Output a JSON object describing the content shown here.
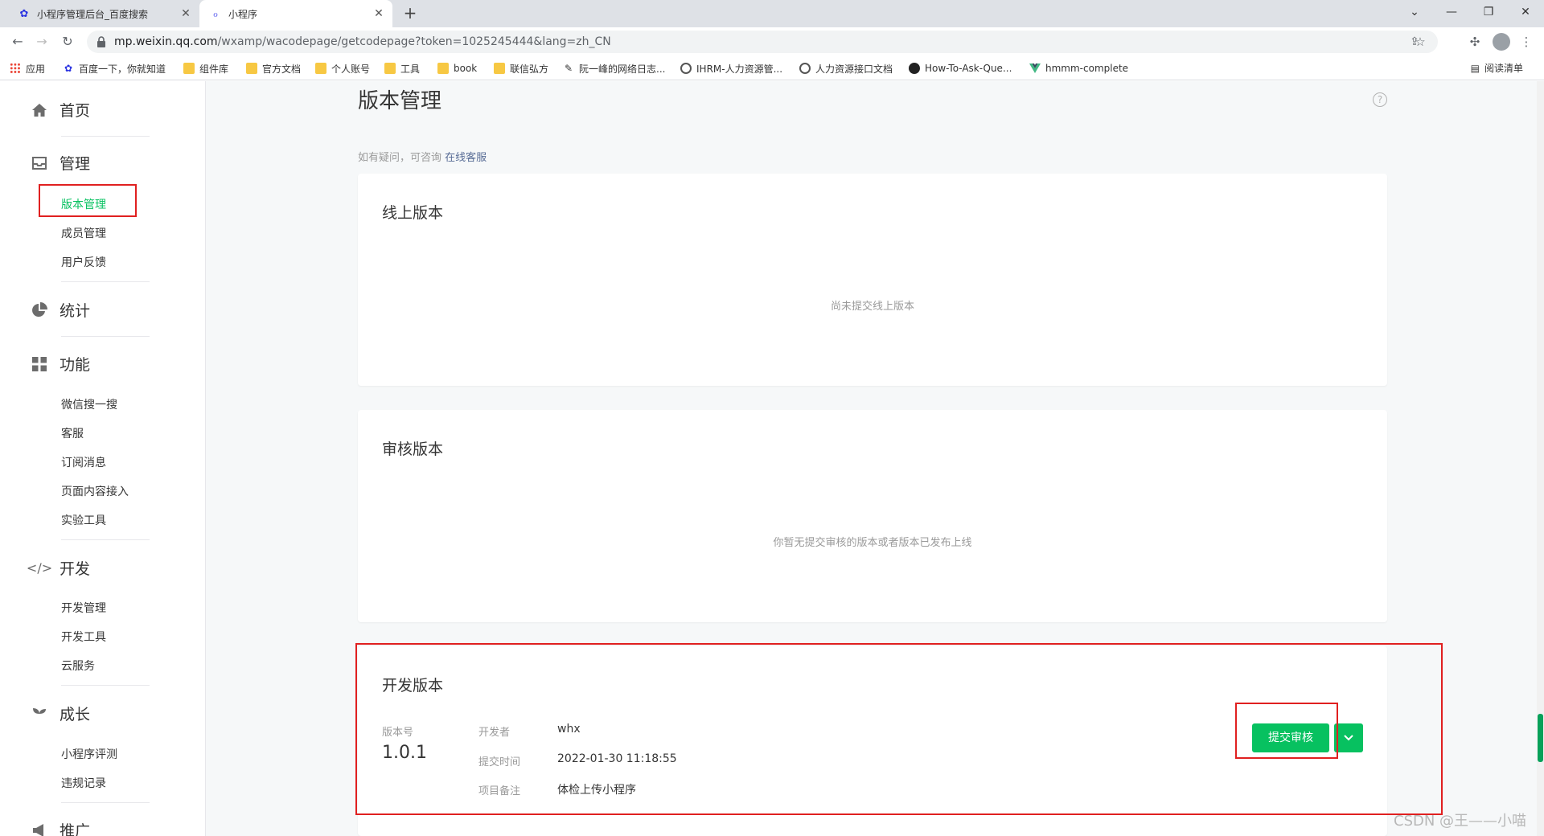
{
  "browser": {
    "tabs": [
      {
        "title": "小程序管理后台_百度搜索",
        "icon": "baidu-paw-icon",
        "active": false
      },
      {
        "title": "小程序",
        "icon": "miniprogram-icon",
        "active": true
      }
    ],
    "url_host": "mp.weixin.qq.com",
    "url_path": "/wxamp/wacodepage/getcodepage?token=1025245444&lang=zh_CN",
    "bookmarks": [
      {
        "label": "应用",
        "icon": "apps-grid-icon"
      },
      {
        "label": "百度一下，你就知道",
        "icon": "baidu-paw-icon"
      },
      {
        "label": "组件库",
        "icon": "folder-icon"
      },
      {
        "label": "官方文档",
        "icon": "folder-icon"
      },
      {
        "label": "个人账号",
        "icon": "folder-icon"
      },
      {
        "label": "工具",
        "icon": "folder-icon"
      },
      {
        "label": "book",
        "icon": "folder-icon"
      },
      {
        "label": "联信弘方",
        "icon": "folder-icon"
      },
      {
        "label": "阮一峰的网络日志...",
        "icon": "blog-icon"
      },
      {
        "label": "IHRM-人力资源管...",
        "icon": "globe-icon"
      },
      {
        "label": "人力资源接口文档",
        "icon": "globe-icon"
      },
      {
        "label": "How-To-Ask-Que...",
        "icon": "github-icon"
      },
      {
        "label": "hmmm-complete",
        "icon": "vue-icon"
      }
    ],
    "reading_list": "阅读清单"
  },
  "sidebar": {
    "home": "首页",
    "manage": "管理",
    "manage_items": [
      "版本管理",
      "成员管理",
      "用户反馈"
    ],
    "stats": "统计",
    "features": "功能",
    "features_items": [
      "微信搜一搜",
      "客服",
      "订阅消息",
      "页面内容接入",
      "实验工具"
    ],
    "dev": "开发",
    "dev_items": [
      "开发管理",
      "开发工具",
      "云服务"
    ],
    "growth": "成长",
    "growth_items": [
      "小程序评测",
      "违规记录"
    ],
    "promote": "推广"
  },
  "main": {
    "title": "版本管理",
    "consult_prefix": "如有疑问，可咨询",
    "consult_link": "在线客服",
    "online": {
      "title": "线上版本",
      "empty": "尚未提交线上版本"
    },
    "review": {
      "title": "审核版本",
      "empty": "你暂无提交审核的版本或者版本已发布上线"
    },
    "dev": {
      "title": "开发版本",
      "version_label": "版本号",
      "version": "1.0.1",
      "developer_label": "开发者",
      "developer": "whx",
      "time_label": "提交时间",
      "time": "2022-01-30 11:18:55",
      "note_label": "项目备注",
      "note": "体检上传小程序",
      "submit_button": "提交审核"
    }
  },
  "watermark": "CSDN @王——小喵",
  "colors": {
    "accent": "#07c160",
    "highlight": "#e02020",
    "link": "#576b95"
  }
}
